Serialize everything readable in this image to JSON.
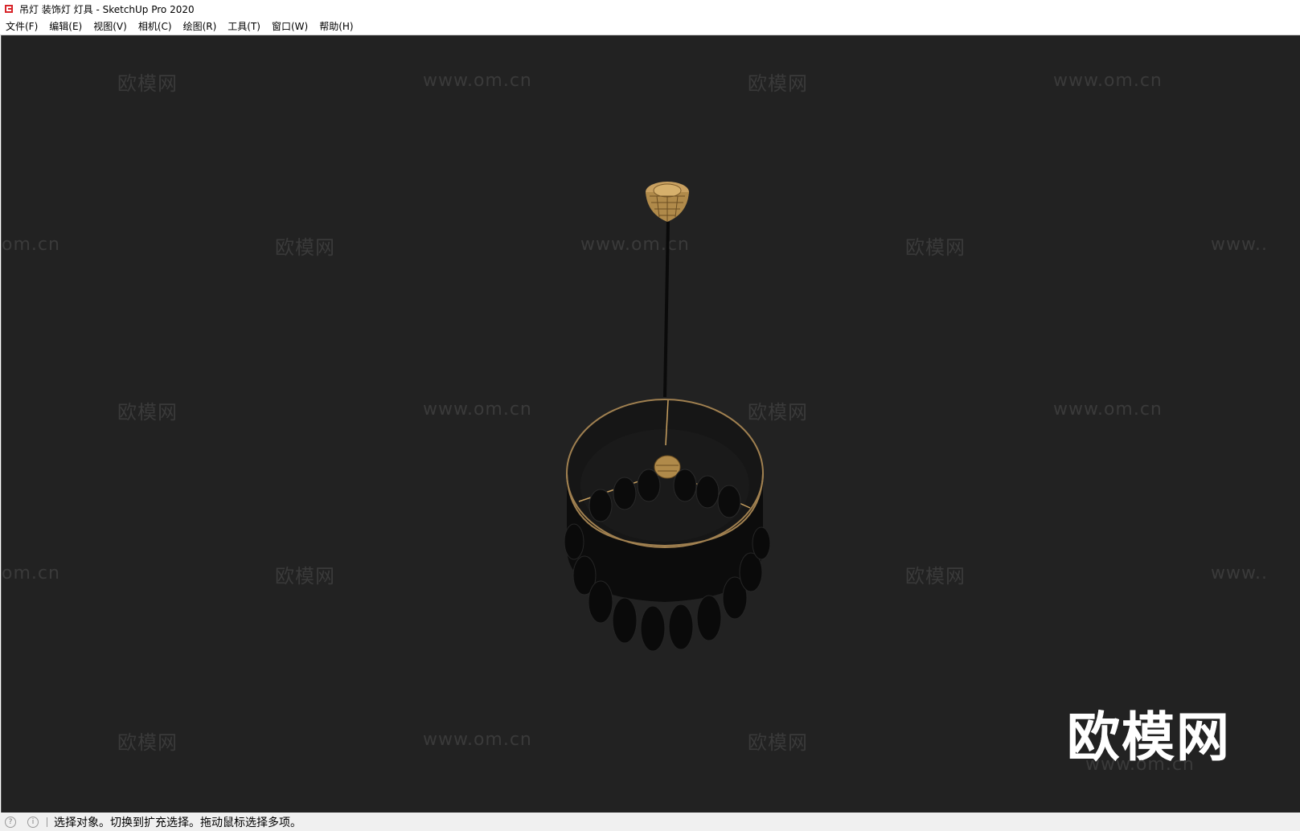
{
  "window": {
    "title": "吊灯 装饰灯 灯具 - SketchUp Pro 2020"
  },
  "menu": [
    "文件(F)",
    "编辑(E)",
    "视图(V)",
    "相机(C)",
    "绘图(R)",
    "工具(T)",
    "窗口(W)",
    "帮助(H)"
  ],
  "watermark": {
    "brand": "欧模网",
    "url": "www.om.cn",
    "url_left": "om.cn",
    "url_right": "www.."
  },
  "big_logo": {
    "text": "欧模网",
    "url": "www.om.cn"
  },
  "status": {
    "text": "选择对象。切换到扩充选择。拖动鼠标选择多项。"
  },
  "colors": {
    "viewport_bg": "#222222",
    "accent_gold": "#c8a060",
    "watermark": "#3a3a3a"
  }
}
